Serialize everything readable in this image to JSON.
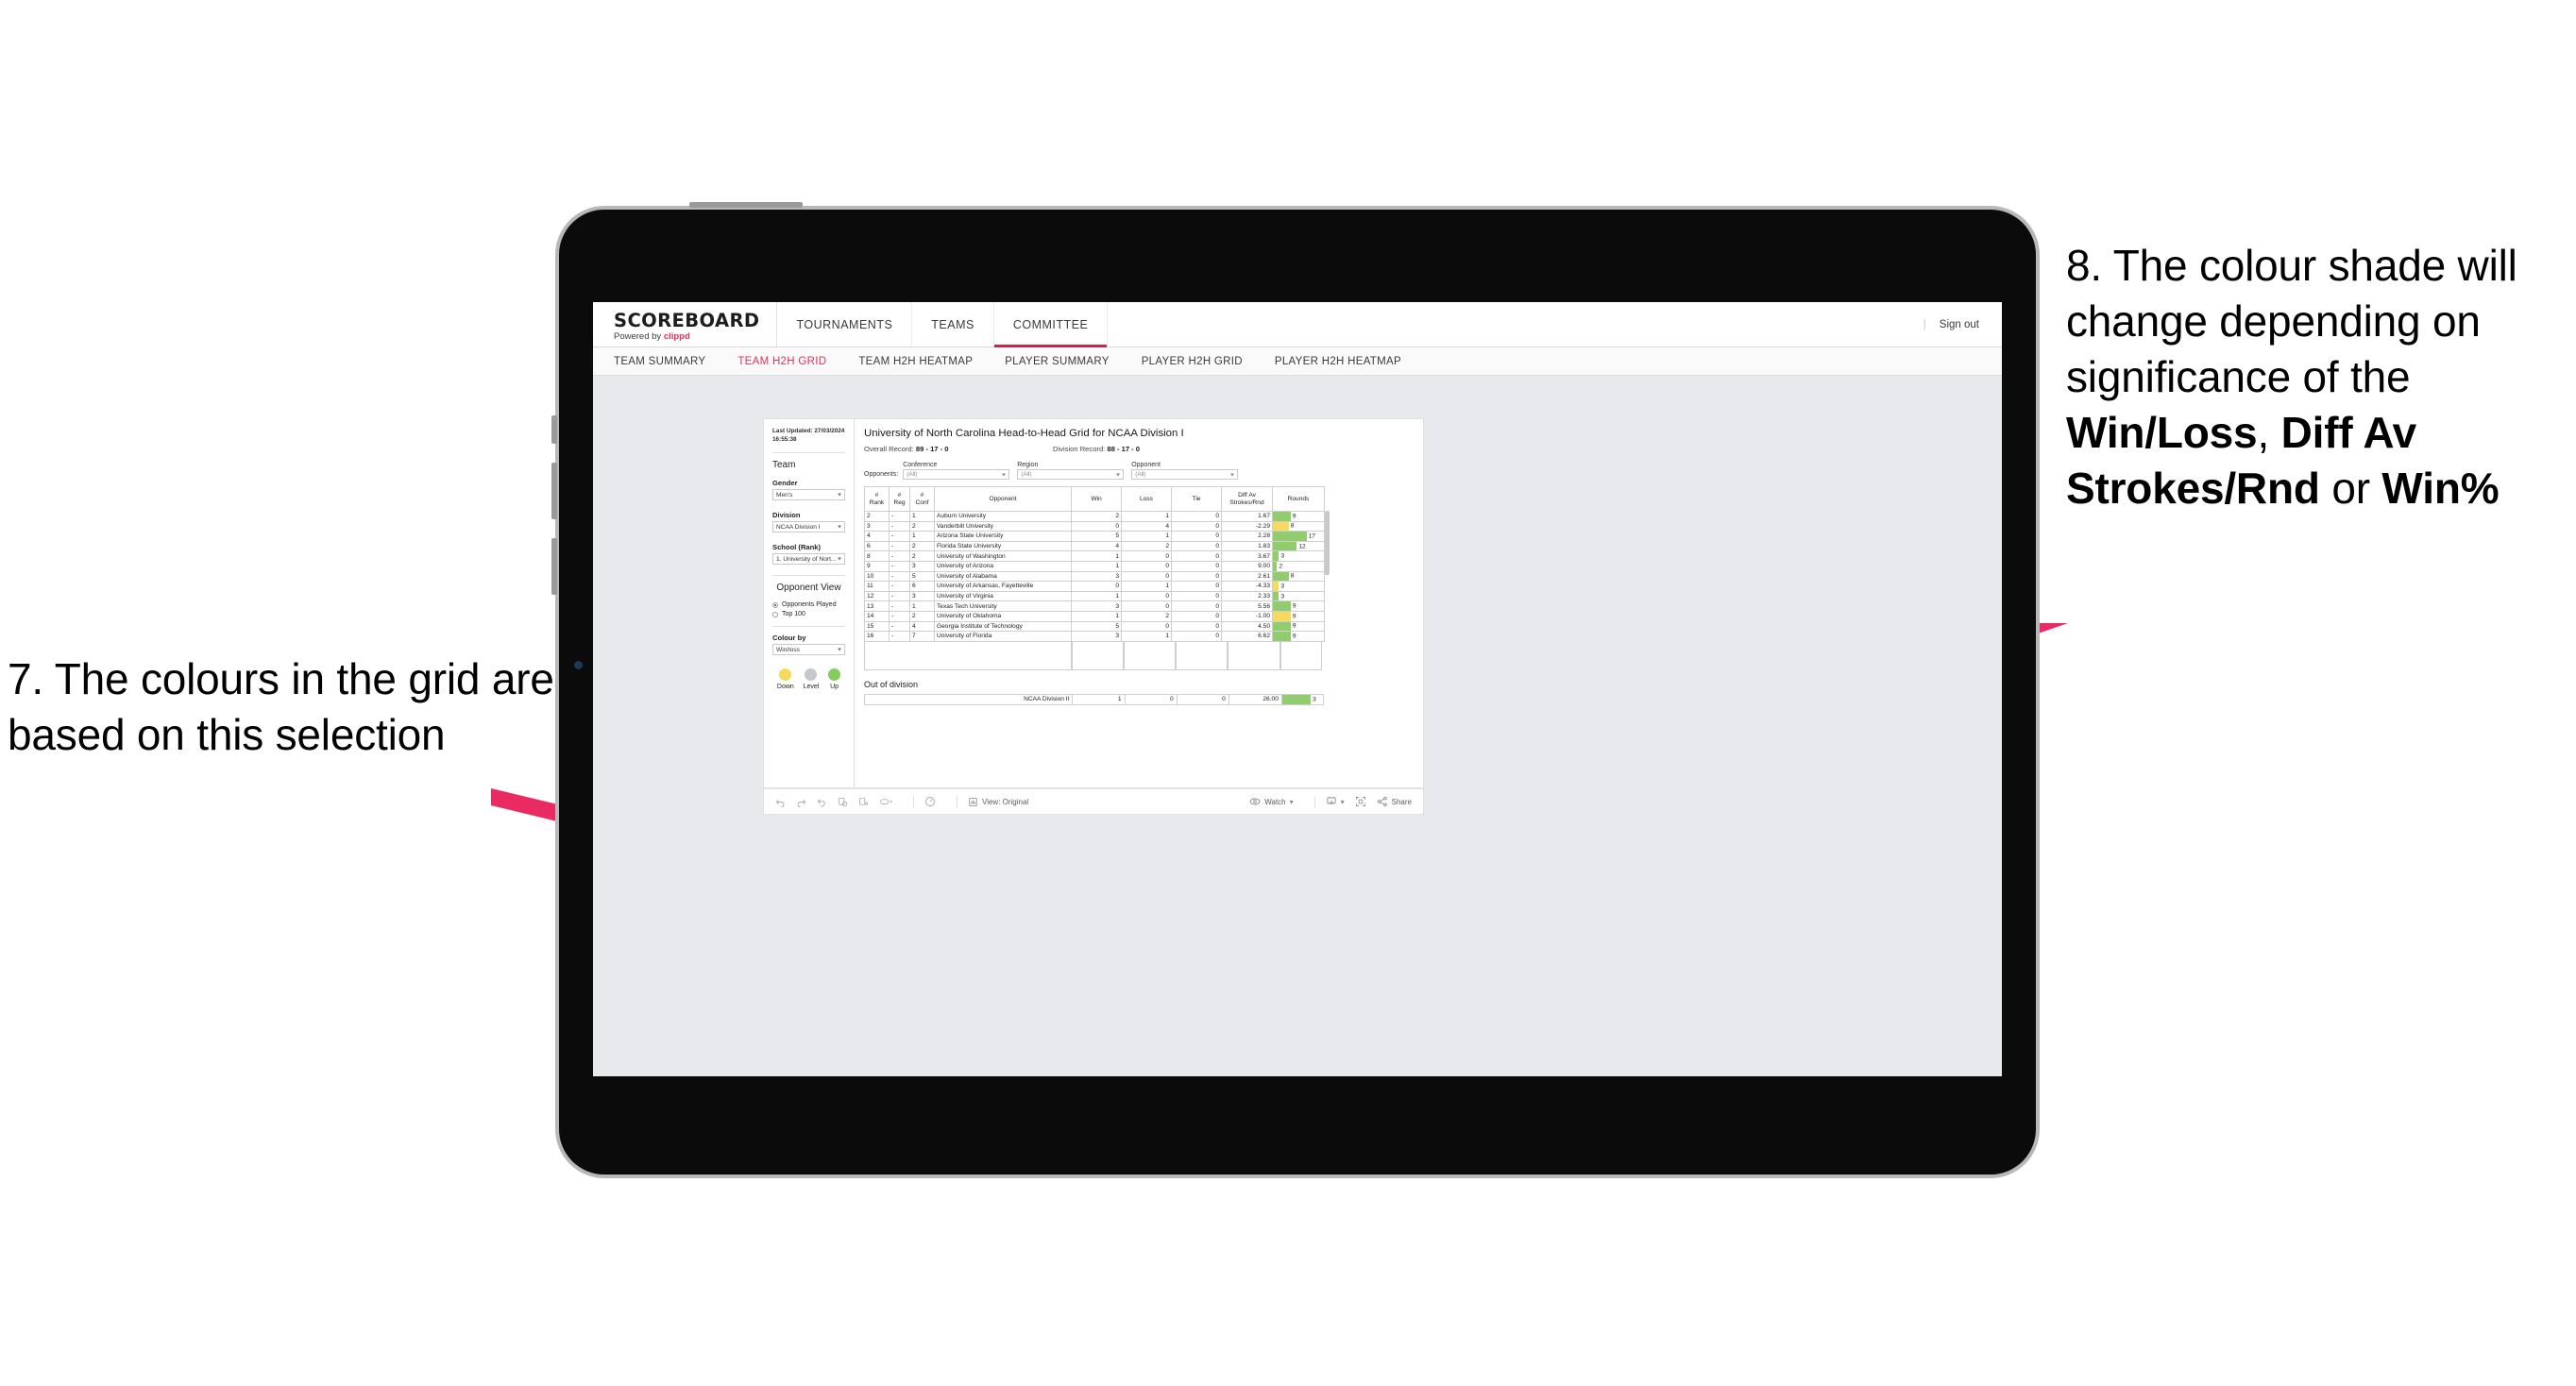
{
  "annotations": {
    "left": {
      "number": "7.",
      "text": "The colours in the grid are based on this selection"
    },
    "right": {
      "number": "8.",
      "lead": "The colour shade will change depending on significance of the ",
      "bold1": "Win/Loss",
      "sep1": ", ",
      "bold2": "Diff Av Strokes/Rnd",
      "sep2": " or ",
      "bold3": "Win%"
    },
    "arrow_color": "#ea2a63"
  },
  "app": {
    "brand": {
      "title": "SCOREBOARD",
      "powered_prefix": "Powered by ",
      "powered_brand": "clippd"
    },
    "nav": [
      {
        "label": "TOURNAMENTS",
        "active": false
      },
      {
        "label": "TEAMS",
        "active": false
      },
      {
        "label": "COMMITTEE",
        "active": true
      }
    ],
    "sign_out": "Sign out",
    "subnav": [
      {
        "label": "TEAM SUMMARY",
        "active": false
      },
      {
        "label": "TEAM H2H GRID",
        "active": true
      },
      {
        "label": "TEAM H2H HEATMAP",
        "active": false
      },
      {
        "label": "PLAYER SUMMARY",
        "active": false
      },
      {
        "label": "PLAYER H2H GRID",
        "active": false
      },
      {
        "label": "PLAYER H2H HEATMAP",
        "active": false
      }
    ]
  },
  "filters": {
    "last_updated": "Last Updated: 27/03/2024 16:55:38",
    "team_heading": "Team",
    "gender_label": "Gender",
    "gender_value": "Men's",
    "division_label": "Division",
    "division_value": "NCAA Division I",
    "school_label": "School (Rank)",
    "school_value": "1. University of Nort...",
    "opponent_view_heading": "Opponent View",
    "opponent_view_options": [
      {
        "label": "Opponents Played",
        "selected": true
      },
      {
        "label": "Top 100",
        "selected": false
      }
    ],
    "colour_by_label": "Colour by",
    "colour_by_value": "Win/loss",
    "legend": [
      {
        "label": "Down",
        "color": "#f6d95f"
      },
      {
        "label": "Level",
        "color": "#c4c7cc"
      },
      {
        "label": "Up",
        "color": "#84cc5e"
      }
    ]
  },
  "report": {
    "title": "University of North Carolina Head-to-Head Grid for NCAA Division I",
    "overall_record_label": "Overall Record:",
    "overall_record_value": "89 - 17 - 0",
    "division_record_label": "Division Record:",
    "division_record_value": "88 - 17 - 0",
    "opponents_label": "Opponents:",
    "opponent_filters": [
      {
        "label": "Conference",
        "value": "(All)"
      },
      {
        "label": "Region",
        "value": "(All)"
      },
      {
        "label": "Opponent",
        "value": "(All)"
      }
    ],
    "columns": [
      {
        "line1": "#",
        "line2": "Rank"
      },
      {
        "line1": "#",
        "line2": "Reg"
      },
      {
        "line1": "#",
        "line2": "Conf"
      },
      {
        "line1": "",
        "line2": "Opponent"
      },
      {
        "line1": "",
        "line2": "Win"
      },
      {
        "line1": "",
        "line2": "Loss"
      },
      {
        "line1": "",
        "line2": "Tie"
      },
      {
        "line1": "Diff Av",
        "line2": "Strokes/Rnd"
      },
      {
        "line1": "",
        "line2": "Rounds"
      }
    ],
    "rows": [
      {
        "rank": "2",
        "reg": "-",
        "conf": "1",
        "opponent": "Auburn University",
        "win": "2",
        "loss": "1",
        "tie": "0",
        "diff": "1.67",
        "rounds": "9",
        "shade": "up",
        "bar_pct": 35
      },
      {
        "rank": "3",
        "reg": "-",
        "conf": "2",
        "opponent": "Vanderbilt University",
        "win": "0",
        "loss": "4",
        "tie": "0",
        "diff": "-2.29",
        "rounds": "8",
        "shade": "down",
        "bar_pct": 31
      },
      {
        "rank": "4",
        "reg": "-",
        "conf": "1",
        "opponent": "Arizona State University",
        "win": "5",
        "loss": "1",
        "tie": "0",
        "diff": "2.28",
        "rounds": "17",
        "shade": "up",
        "bar_pct": 66
      },
      {
        "rank": "6",
        "reg": "-",
        "conf": "2",
        "opponent": "Florida State University",
        "win": "4",
        "loss": "2",
        "tie": "0",
        "diff": "1.83",
        "rounds": "12",
        "shade": "up",
        "bar_pct": 47
      },
      {
        "rank": "8",
        "reg": "-",
        "conf": "2",
        "opponent": "University of Washington",
        "win": "1",
        "loss": "0",
        "tie": "0",
        "diff": "3.67",
        "rounds": "3",
        "shade": "up",
        "bar_pct": 12
      },
      {
        "rank": "9",
        "reg": "-",
        "conf": "3",
        "opponent": "University of Arizona",
        "win": "1",
        "loss": "0",
        "tie": "0",
        "diff": "9.00",
        "rounds": "2",
        "shade": "up",
        "bar_pct": 8
      },
      {
        "rank": "10",
        "reg": "-",
        "conf": "5",
        "opponent": "University of Alabama",
        "win": "3",
        "loss": "0",
        "tie": "0",
        "diff": "2.61",
        "rounds": "8",
        "shade": "up",
        "bar_pct": 31
      },
      {
        "rank": "11",
        "reg": "-",
        "conf": "6",
        "opponent": "University of Arkansas, Fayetteville",
        "win": "0",
        "loss": "1",
        "tie": "0",
        "diff": "-4.33",
        "rounds": "3",
        "shade": "down",
        "bar_pct": 12
      },
      {
        "rank": "12",
        "reg": "-",
        "conf": "3",
        "opponent": "University of Virginia",
        "win": "1",
        "loss": "0",
        "tie": "0",
        "diff": "2.33",
        "rounds": "3",
        "shade": "up",
        "bar_pct": 12
      },
      {
        "rank": "13",
        "reg": "-",
        "conf": "1",
        "opponent": "Texas Tech University",
        "win": "3",
        "loss": "0",
        "tie": "0",
        "diff": "5.56",
        "rounds": "9",
        "shade": "up",
        "bar_pct": 35
      },
      {
        "rank": "14",
        "reg": "-",
        "conf": "2",
        "opponent": "University of Oklahoma",
        "win": "1",
        "loss": "2",
        "tie": "0",
        "diff": "-1.00",
        "rounds": "9",
        "shade": "down",
        "bar_pct": 35
      },
      {
        "rank": "15",
        "reg": "-",
        "conf": "4",
        "opponent": "Georgia Institute of Technology",
        "win": "5",
        "loss": "0",
        "tie": "0",
        "diff": "4.50",
        "rounds": "9",
        "shade": "up",
        "bar_pct": 35
      },
      {
        "rank": "16",
        "reg": "-",
        "conf": "7",
        "opponent": "University of Florida",
        "win": "3",
        "loss": "1",
        "tie": "0",
        "diff": "6.62",
        "rounds": "9",
        "shade": "up",
        "bar_pct": 35
      }
    ],
    "out_of_division_title": "Out of division",
    "out_of_division_rows": [
      {
        "opponent": "NCAA Division II",
        "win": "1",
        "loss": "0",
        "tie": "0",
        "diff": "26.00",
        "rounds": "3",
        "shade": "up",
        "bar_pct": 70
      }
    ],
    "colors": {
      "up": "#91cc6e",
      "down": "#f6d95f"
    }
  },
  "toolbar": {
    "icons": [
      "undo-icon",
      "redo-icon",
      "revert-icon",
      "refresh-data-icon",
      "pause-data-icon",
      "highlight-icon"
    ],
    "view_label": "View: Original",
    "watch_label": "Watch",
    "share_label": "Share"
  }
}
